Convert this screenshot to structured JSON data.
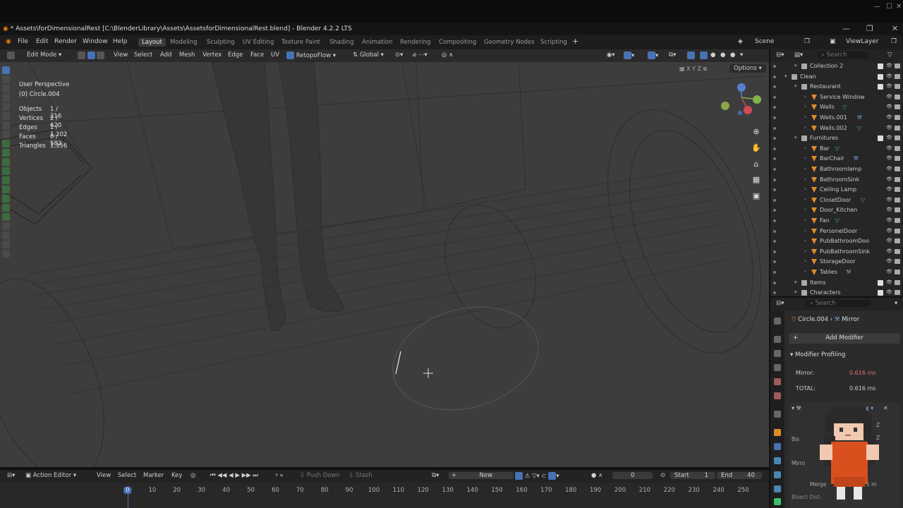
{
  "window": {
    "title": "* Assets\\forDimensionalRest [C:\\BlenderLibrary\\Assets\\AssetsforDimensionalRest.blend] - Blender 4.2.2 LTS",
    "os_controls": [
      "—",
      "☐",
      "✕"
    ]
  },
  "menu": [
    "File",
    "Edit",
    "Render",
    "Window",
    "Help"
  ],
  "workspaces": [
    "Layout",
    "Modeling",
    "Sculpting",
    "UV Editing",
    "Texture Paint",
    "Shading",
    "Animation",
    "Rendering",
    "Compositing",
    "Geometry Nodes",
    "Scripting"
  ],
  "active_workspace": "Layout",
  "scene": {
    "label": "Scene",
    "view_layer": "ViewLayer"
  },
  "viewport_header": {
    "mode": "Edit Mode",
    "menus": [
      "View",
      "Select",
      "Add",
      "Mesh",
      "Vertex",
      "Edge",
      "Face",
      "UV"
    ],
    "addon": "RetopoFlow",
    "orientation": "Global",
    "options": "Options",
    "axes": [
      "X",
      "Y",
      "Z"
    ]
  },
  "viewport_info": {
    "view": "User Perspective",
    "object": "(0) Circle.004",
    "stats": [
      {
        "label": "Objects",
        "value": "1 / 216"
      },
      {
        "label": "Vertices",
        "value": "2 / 620"
      },
      {
        "label": "Edges",
        "value": "1 / 1,202"
      },
      {
        "label": "Faces",
        "value": "0 / 582"
      },
      {
        "label": "Triangles",
        "value": "1,156"
      }
    ]
  },
  "timeline": {
    "editor": "Action Editor",
    "menus": [
      "View",
      "Select",
      "Marker",
      "Key"
    ],
    "push_down": "Push Down",
    "stash": "Stash",
    "new": "New",
    "current_frame": "0",
    "start_label": "Start",
    "start": "1",
    "end_label": "End",
    "end": "40",
    "ticks": [
      "0",
      "10",
      "20",
      "30",
      "40",
      "50",
      "60",
      "70",
      "80",
      "90",
      "100",
      "110",
      "120",
      "130",
      "140",
      "150",
      "160",
      "170",
      "180",
      "190",
      "200",
      "210",
      "220",
      "230",
      "240",
      "250"
    ]
  },
  "outliner": {
    "search_placeholder": "Search",
    "rows": [
      {
        "label": "Collection 2",
        "indent": 2,
        "icon": "collection",
        "partial": true
      },
      {
        "label": "Clean",
        "indent": 1,
        "icon": "collection"
      },
      {
        "label": "Restaurant",
        "indent": 2,
        "icon": "collection"
      },
      {
        "label": "Service Window",
        "indent": 3,
        "icon": "mesh"
      },
      {
        "label": "Walls",
        "indent": 3,
        "icon": "mesh",
        "extra": "modifier"
      },
      {
        "label": "Walls.001",
        "indent": 3,
        "icon": "mesh",
        "extra": "wrench"
      },
      {
        "label": "Walls.002",
        "indent": 3,
        "icon": "mesh",
        "extra": "modifier"
      },
      {
        "label": "Furnitures",
        "indent": 2,
        "icon": "collection"
      },
      {
        "label": "Bar",
        "indent": 3,
        "icon": "mesh",
        "extra": "modifier"
      },
      {
        "label": "BarChair",
        "indent": 3,
        "icon": "mesh",
        "extra": "wrench"
      },
      {
        "label": "Bathroomlamp",
        "indent": 3,
        "icon": "mesh"
      },
      {
        "label": "BathroomSink",
        "indent": 3,
        "icon": "mesh"
      },
      {
        "label": "Ceiling Lamp",
        "indent": 3,
        "icon": "mesh"
      },
      {
        "label": "ClosetDoor",
        "indent": 3,
        "icon": "mesh",
        "extra": "modifier"
      },
      {
        "label": "Door_Kitchen",
        "indent": 3,
        "icon": "mesh"
      },
      {
        "label": "Fan",
        "indent": 3,
        "icon": "mesh",
        "extra": "modifier"
      },
      {
        "label": "PersonelDoor",
        "indent": 3,
        "icon": "mesh"
      },
      {
        "label": "PubBathroomDoo",
        "indent": 3,
        "icon": "mesh"
      },
      {
        "label": "PubBathroomSink",
        "indent": 3,
        "icon": "mesh"
      },
      {
        "label": "StorageDoor",
        "indent": 3,
        "icon": "mesh"
      },
      {
        "label": "Tables",
        "indent": 3,
        "icon": "mesh",
        "extra": "wrench"
      },
      {
        "label": "Items",
        "indent": 2,
        "icon": "collection"
      },
      {
        "label": "Characters",
        "indent": 2,
        "icon": "collection"
      }
    ]
  },
  "properties": {
    "search_placeholder": "Search",
    "breadcrumb_object": "Circle.004",
    "breadcrumb_modifier": "Mirror",
    "add_modifier": "Add Modifier",
    "profiling_title": "Modifier Profiling",
    "mirror_label": "Mirror:",
    "mirror_time": "0.616 ms",
    "total_label": "TOTAL:",
    "total_time": "0.616 ms",
    "partial_labels": [
      "Bis",
      "Mirro",
      "Merge",
      "Bisect Dist."
    ],
    "partial_values": [
      "Z",
      "Z",
      "1 m"
    ]
  },
  "colors": {
    "accent": "#4772b3",
    "viewport_bg": "#3d3d3d",
    "mesh_orange": "#e08a2a",
    "modifier_green": "#3fbf6b",
    "time_red": "#e07070"
  }
}
